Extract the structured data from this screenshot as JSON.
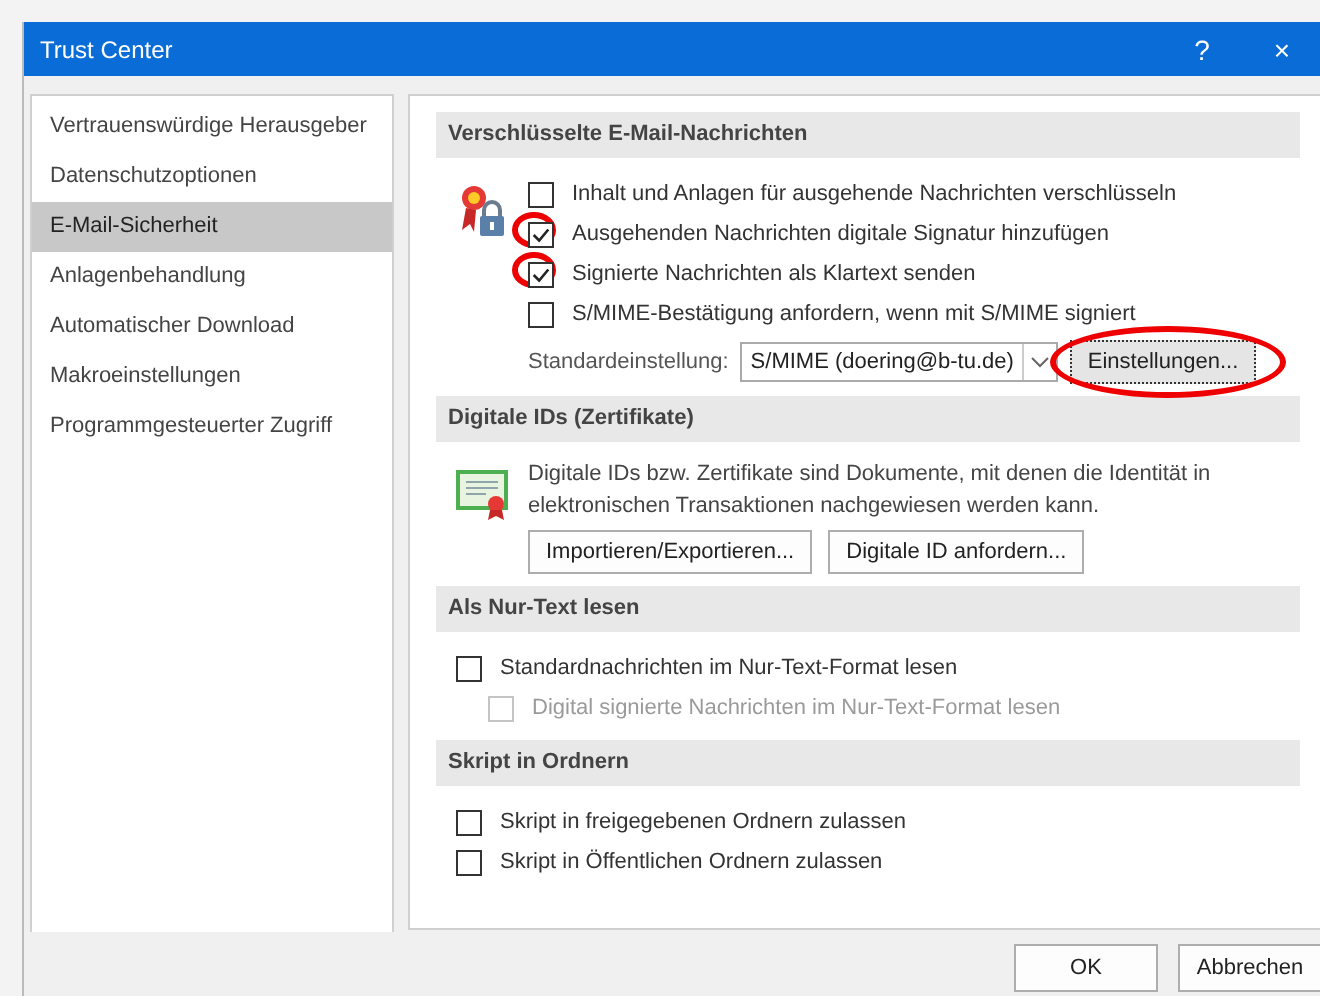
{
  "window": {
    "title": "Trust Center",
    "help": "?",
    "close": "×"
  },
  "sidebar": {
    "items": [
      {
        "label": "Vertrauenswürdige Herausgeber",
        "selected": false
      },
      {
        "label": "Datenschutzoptionen",
        "selected": false
      },
      {
        "label": "E-Mail-Sicherheit",
        "selected": true
      },
      {
        "label": "Anlagenbehandlung",
        "selected": false
      },
      {
        "label": "Automatischer Download",
        "selected": false
      },
      {
        "label": "Makroeinstellungen",
        "selected": false
      },
      {
        "label": "Programmgesteuerter Zugriff",
        "selected": false
      }
    ]
  },
  "sections": [
    {
      "title": "Verschlüsselte E-Mail-Nachrichten",
      "options": [
        {
          "label": "Inhalt und Anlagen für ausgehende Nachrichten verschlüsseln",
          "checked": false,
          "disabled": false,
          "circled": false,
          "indented": false
        },
        {
          "label": "Ausgehenden Nachrichten digitale Signatur hinzufügen",
          "checked": true,
          "disabled": false,
          "circled": true,
          "indented": false
        },
        {
          "label": "Signierte Nachrichten als Klartext senden",
          "checked": true,
          "disabled": false,
          "circled": true,
          "indented": false
        },
        {
          "label": "S/MIME-Bestätigung anfordern, wenn mit S/MIME signiert",
          "checked": false,
          "disabled": false,
          "circled": false,
          "indented": false
        }
      ],
      "setting": {
        "label": "Standardeinstellung:",
        "value": "S/MIME (doering@b-tu.de)",
        "button": {
          "label": "Einstellungen...",
          "circled": true
        }
      }
    },
    {
      "title": "Digitale IDs (Zertifikate)",
      "description": "Digitale IDs bzw. Zertifikate sind Dokumente, mit denen die Identität in elektronischen Transaktionen nachgewiesen werden kann.",
      "buttons": [
        "Importieren/Exportieren...",
        "Digitale ID anfordern..."
      ]
    },
    {
      "title": "Als Nur-Text lesen",
      "options": [
        {
          "label": "Standardnachrichten im Nur-Text-Format lesen",
          "checked": false,
          "disabled": false,
          "circled": false,
          "indented": false
        },
        {
          "label": "Digital signierte Nachrichten im Nur-Text-Format lesen",
          "checked": false,
          "disabled": true,
          "circled": false,
          "indented": true
        }
      ]
    },
    {
      "title": "Skript in Ordnern",
      "options": [
        {
          "label": "Skript in freigegebenen Ordnern zulassen",
          "checked": false,
          "disabled": false,
          "circled": false,
          "indented": false
        },
        {
          "label": "Skript in Öffentlichen Ordnern zulassen",
          "checked": false,
          "disabled": false,
          "circled": false,
          "indented": false
        }
      ]
    }
  ],
  "footer": {
    "buttons": [
      "OK",
      "Abbrechen"
    ]
  }
}
